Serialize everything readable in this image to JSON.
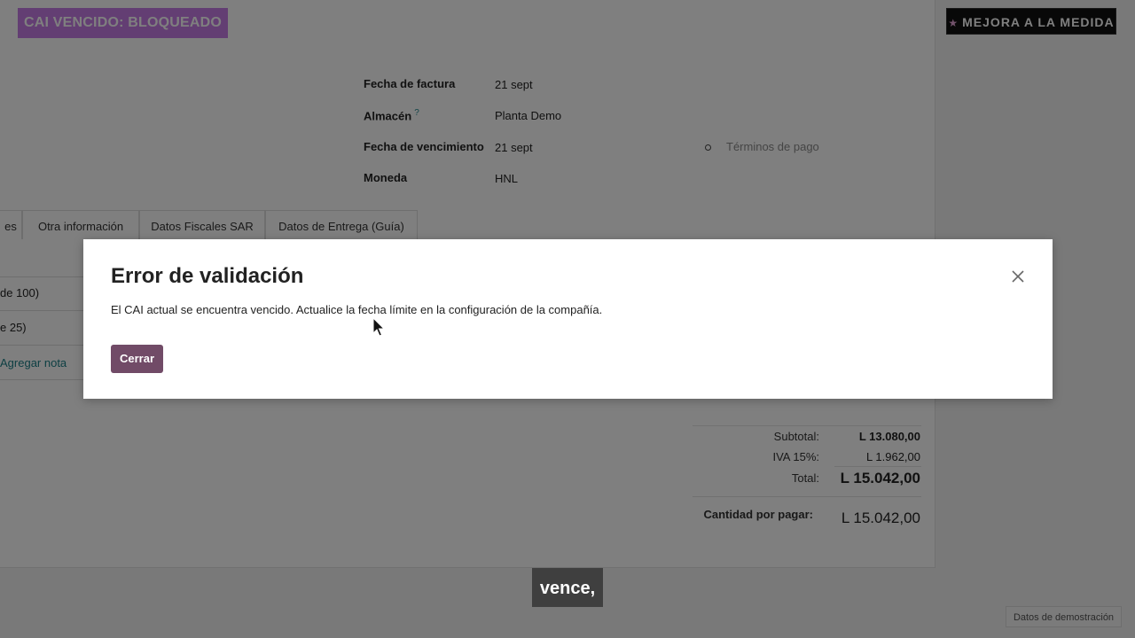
{
  "banner": {
    "status": "CAI VENCIDO: BLOQUEADO"
  },
  "promo": {
    "star": "★",
    "label": "MEJORA A LA MEDIDA"
  },
  "invoice": {
    "fields": [
      {
        "label": "Fecha de factura",
        "value": "21 sept"
      },
      {
        "label": "Almacén",
        "help": "?",
        "value": "Planta Demo"
      },
      {
        "label": "Fecha de vencimiento",
        "value": "21 sept"
      },
      {
        "label": "Moneda",
        "value": "HNL"
      }
    ],
    "payment_terms_placeholder": "Términos de pago"
  },
  "tabs": [
    "es",
    "Otra información",
    "Datos Fiscales SAR",
    "Datos de Entrega (Guía)"
  ],
  "lines": [
    "de 100)",
    "e 25)"
  ],
  "add_note": "Agregar nota",
  "totals": {
    "subtotal_label": "Subtotal:",
    "subtotal": "L 13.080,00",
    "iva_label": "IVA 15%:",
    "iva": "L 1.962,00",
    "total_label": "Total:",
    "total": "L 15.042,00",
    "due_label": "Cantidad por pagar:",
    "due": "L 15.042,00"
  },
  "dialog": {
    "title": "Error de validación",
    "message": "El CAI actual se encuentra vencido. Actualice la fecha límite en la configuración de la compañía.",
    "close_button": "Cerrar"
  },
  "subtitle": "vence,",
  "demo_badge": "Datos de demostración",
  "colors": {
    "banner": "#c77ce6",
    "primary": "#714b67",
    "link": "#1b7f87",
    "overlay": "rgba(0,0,0,0.5)"
  }
}
